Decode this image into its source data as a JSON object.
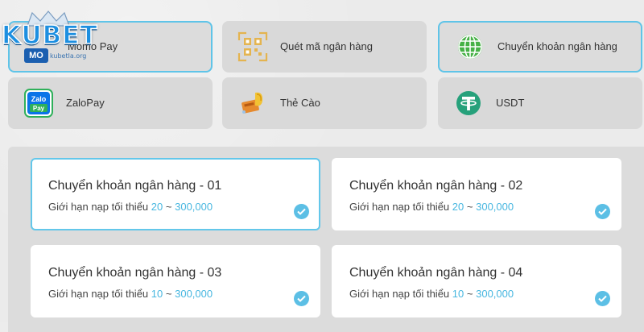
{
  "logo": {
    "brand": "KUBET",
    "badge": "MO",
    "site": "kubetla.org"
  },
  "methods": [
    {
      "label": "Momo Pay",
      "icon": "momo-icon",
      "selected": true
    },
    {
      "label": "Quét mã ngân hàng",
      "icon": "qr-code-icon",
      "selected": false
    },
    {
      "label": "Chuyển khoản ngân hàng",
      "icon": "globe-icon",
      "selected": true
    },
    {
      "label": "ZaloPay",
      "icon": "zalopay-icon",
      "selected": false
    },
    {
      "label": "Thẻ Cào",
      "icon": "scratch-card-icon",
      "selected": false
    },
    {
      "label": "USDT",
      "icon": "tether-icon",
      "selected": false
    }
  ],
  "zalopay_logo_text": {
    "line1": "Zalo",
    "line2": "Pay"
  },
  "channels": [
    {
      "title": "Chuyển khoản ngân hàng - 01",
      "limit_label": "Giới hạn nạp tối thiểu",
      "min": "20",
      "sep": "~",
      "max": "300,000",
      "selected": true
    },
    {
      "title": "Chuyển khoản ngân hàng - 02",
      "limit_label": "Giới hạn nạp tối thiểu",
      "min": "20",
      "sep": "~",
      "max": "300,000",
      "selected": false
    },
    {
      "title": "Chuyển khoản ngân hàng - 03",
      "limit_label": "Giới hạn nạp tối thiểu",
      "min": "10",
      "sep": "~",
      "max": "300,000",
      "selected": false
    },
    {
      "title": "Chuyển khoản ngân hàng - 04",
      "limit_label": "Giới hạn nạp tối thiểu",
      "min": "10",
      "sep": "~",
      "max": "300,000",
      "selected": false
    }
  ],
  "colors": {
    "accent": "#5fc4e8",
    "number": "#48b7e0",
    "tile_bg": "#d9d9d9",
    "panel_bg": "#dcdcdc",
    "tether": "#26a17b",
    "globe": "#3aa53a",
    "zalo": "#0068ff"
  }
}
